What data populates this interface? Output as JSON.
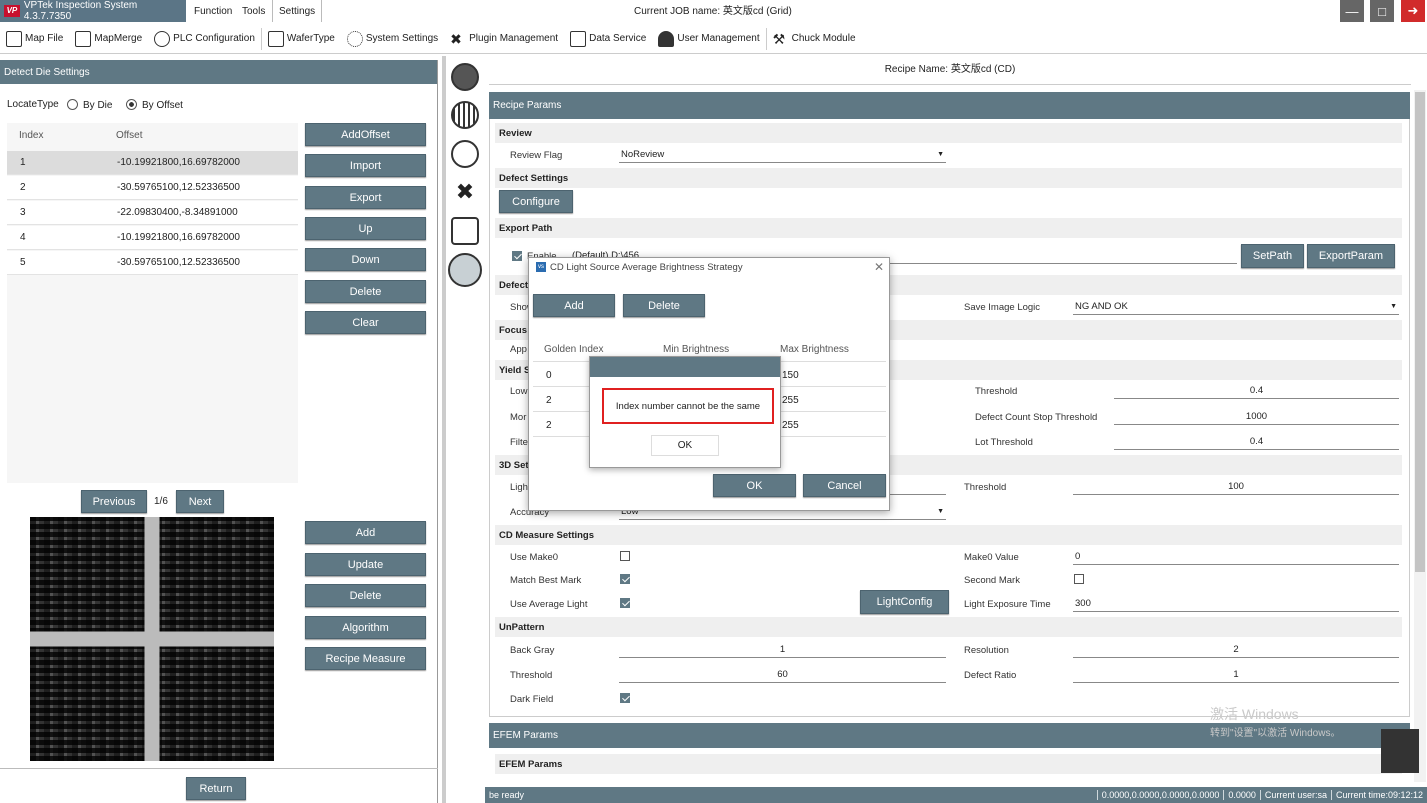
{
  "app": {
    "title": "VPTek Inspection System 4.3.7.7350",
    "menus": [
      "Function",
      "Tools",
      "Settings"
    ],
    "job_title": "Current JOB name: 英文版cd (Grid)"
  },
  "toolbar": {
    "items": [
      "Map File",
      "MapMerge",
      "PLC Configuration",
      "WaferType",
      "System Settings",
      "Plugin Management",
      "Data Service",
      "User Management",
      "Chuck Module"
    ]
  },
  "left": {
    "header": "Detect Die Settings",
    "locate_label": "LocateType",
    "radio_by_die": "By Die",
    "radio_by_offset": "By Offset",
    "col_index": "Index",
    "col_offset": "Offset",
    "rows": [
      {
        "index": "1",
        "offset": "-10.19921800,16.69782000"
      },
      {
        "index": "2",
        "offset": "-30.59765100,12.52336500"
      },
      {
        "index": "3",
        "offset": "-22.09830400,-8.34891000"
      },
      {
        "index": "4",
        "offset": "-10.19921800,16.69782000"
      },
      {
        "index": "5",
        "offset": "-30.59765100,12.52336500"
      }
    ],
    "buttons_top": [
      "AddOffset",
      "Import",
      "Export",
      "Up",
      "Down",
      "Delete",
      "Clear"
    ],
    "prev": "Previous",
    "page": "1/6",
    "next": "Next",
    "buttons_bottom": [
      "Add",
      "Update",
      "Delete",
      "Algorithm",
      "Recipe Measure"
    ],
    "return": "Return"
  },
  "right": {
    "recipe_name": "Recipe Name: 英文版cd (CD)",
    "recipe_params": "Recipe Params",
    "review": "Review",
    "review_flag_label": "Review Flag",
    "review_flag_value": "NoReview",
    "defect_settings": "Defect Settings",
    "configure": "Configure",
    "export_path": "Export Path",
    "enable_text": "Enable",
    "path_value": "(Default) D:\\456",
    "setpath": "SetPath",
    "exportparam": "ExportParam",
    "defect_trunc": "Defect",
    "show_trunc": "Show",
    "save_image_label": "Save Image Logic",
    "save_image_value": "NG AND OK",
    "focus_trunc": "Focus",
    "app_trunc": "App",
    "yield_trunc": "Yield S",
    "low_trunc": "Low",
    "mor_trunc": "Mor",
    "filt_trunc": "Filte",
    "threshold_label": "Threshold",
    "threshold_value": "0.4",
    "dcst_label": "Defect Count Stop Threshold",
    "dcst_value": "1000",
    "lot_label": "Lot Threshold",
    "lot_value": "0.4",
    "set3d_trunc": "3D Set",
    "ligh_trunc": "Ligh",
    "threshold3d_label": "Threshold",
    "threshold3d_value": "100",
    "accuracy_label": "Accuracy",
    "accuracy_value": "Low",
    "cd_measure": "CD Measure Settings",
    "use_make0": "Use Make0",
    "make0_value_label": "Make0 Value",
    "make0_value": "0",
    "match_best": "Match Best Mark",
    "second_mark": "Second Mark",
    "use_avg_light": "Use Average Light",
    "lightconfig": "LightConfig",
    "exposure_label": "Light Exposure Time",
    "exposure_value": "300",
    "unpattern": "UnPattern",
    "back_gray": "Back Gray",
    "back_gray_value": "1",
    "resolution": "Resolution",
    "resolution_value": "2",
    "up_threshold": "Threshold",
    "up_threshold_value": "60",
    "defect_ratio": "Defect Ratio",
    "defect_ratio_value": "1",
    "dark_field": "Dark Field",
    "efem_params": "EFEM Params",
    "efem_sub": "EFEM Params"
  },
  "dialog": {
    "title": "CD Light Source Average Brightness Strategy",
    "add": "Add",
    "delete": "Delete",
    "col1": "Golden Index",
    "col2": "Min Brightness",
    "col3": "Max Brightness",
    "rows": [
      {
        "gi": "0",
        "max": "150"
      },
      {
        "gi": "2",
        "max": "255"
      },
      {
        "gi": "2",
        "max": "255"
      }
    ],
    "ok": "OK",
    "cancel": "Cancel"
  },
  "alert": {
    "message": "Index number cannot be the same",
    "ok": "OK"
  },
  "watermark": {
    "line1": "激活 Windows",
    "line2": "转到\"设置\"以激活 Windows。"
  },
  "status": {
    "ready": "be ready",
    "coords": "0.0000,0.0000,0.0000,0.0000",
    "value": "0.0000",
    "user": "Current user:sa",
    "time": "Current time:09:12:12"
  }
}
